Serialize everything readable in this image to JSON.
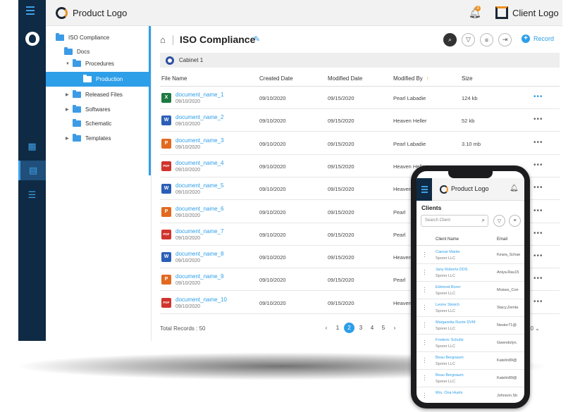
{
  "header": {
    "product_logo": "Product Logo",
    "client_logo": "Client Logo",
    "notification_count": "3"
  },
  "tree": {
    "items": [
      {
        "label": "ISO Compliance"
      },
      {
        "label": "Docs"
      },
      {
        "label": "Procedures"
      },
      {
        "label": "Production"
      },
      {
        "label": "Released Files"
      },
      {
        "label": "Softwares"
      },
      {
        "label": "Schematic"
      },
      {
        "label": "Templates"
      }
    ]
  },
  "main": {
    "title": "ISO Compliance",
    "record_label": "Record",
    "cabinet": "Cabinet 1",
    "columns": {
      "file_name": "File Name",
      "created": "Created Date",
      "modified": "Modified Date",
      "modified_by": "Modified By",
      "size": "Size"
    },
    "rows": [
      {
        "icon": "X",
        "icon_color": "#1e7a43",
        "name": "document_name_1",
        "sub": "09/10/2020",
        "created": "09/10/2020",
        "modified": "09/15/2020",
        "by": "Pearl Labadie",
        "size": "124 kb"
      },
      {
        "icon": "W",
        "icon_color": "#2b5fb7",
        "name": "document_name_2",
        "sub": "09/10/2020",
        "created": "09/10/2020",
        "modified": "09/15/2020",
        "by": "Heaven Heller",
        "size": "52 kb"
      },
      {
        "icon": "P",
        "icon_color": "#e2691f",
        "name": "document_name_3",
        "sub": "09/10/2020",
        "created": "09/10/2020",
        "modified": "09/15/2020",
        "by": "Pearl Labadie",
        "size": "3.10 mb"
      },
      {
        "icon": "PDF",
        "icon_color": "#d0342c",
        "name": "document_name_4",
        "sub": "09/10/2020",
        "created": "09/10/2020",
        "modified": "09/15/2020",
        "by": "Heaven Heller",
        "size": ""
      },
      {
        "icon": "W",
        "icon_color": "#2b5fb7",
        "name": "document_name_5",
        "sub": "09/10/2020",
        "created": "09/10/2020",
        "modified": "09/15/2020",
        "by": "Heaven",
        "size": ""
      },
      {
        "icon": "P",
        "icon_color": "#e2691f",
        "name": "document_name_6",
        "sub": "09/10/2020",
        "created": "09/10/2020",
        "modified": "09/15/2020",
        "by": "Pearl",
        "size": ""
      },
      {
        "icon": "PDF",
        "icon_color": "#d0342c",
        "name": "document_name_7",
        "sub": "09/10/2020",
        "created": "09/10/2020",
        "modified": "09/15/2020",
        "by": "Pearl",
        "size": ""
      },
      {
        "icon": "W",
        "icon_color": "#2b5fb7",
        "name": "document_name_8",
        "sub": "09/10/2020",
        "created": "09/10/2020",
        "modified": "09/15/2020",
        "by": "Heaven",
        "size": ""
      },
      {
        "icon": "P",
        "icon_color": "#e2691f",
        "name": "document_name_9",
        "sub": "09/10/2020",
        "created": "09/10/2020",
        "modified": "09/15/2020",
        "by": "Pearl",
        "size": ""
      },
      {
        "icon": "PDF",
        "icon_color": "#d0342c",
        "name": "document_name_10",
        "sub": "09/10/2020",
        "created": "09/10/2020",
        "modified": "09/15/2020",
        "by": "Heaven",
        "size": ""
      }
    ],
    "total_records": "Total Records : 50",
    "pages": [
      "1",
      "2",
      "3",
      "4",
      "5"
    ],
    "current_page": "2",
    "per_page": "10"
  },
  "phone": {
    "product_logo": "Product Logo",
    "notification_count": "3",
    "title": "Clients",
    "search_placeholder": "Search Client",
    "columns": {
      "client_name": "Client Name",
      "email": "Email"
    },
    "rows": [
      {
        "name": "Caesar Mante",
        "company": "Sporer LLC",
        "email": "Keara_Schae"
      },
      {
        "name": "Jany Roberts DDS",
        "company": "Sporer LLC",
        "email": "Aniya.Rau15"
      },
      {
        "name": "Edmond Borer",
        "company": "Sporer LLC",
        "email": "Moises_Con"
      },
      {
        "name": "Leone Streich",
        "company": "Sporer LLC",
        "email": "Stacy.Zemla"
      },
      {
        "name": "Margaretta Runte DVM",
        "company": "Sporer LLC",
        "email": "Nestor71@"
      },
      {
        "name": "Frederic Schultz",
        "company": "Sporer LLC",
        "email": "Gwendolyn."
      },
      {
        "name": "Beau Bergnaum",
        "company": "Sporer LLC",
        "email": "Katelin89@"
      },
      {
        "name": "Beau Bergnaum",
        "company": "Sporer LLC",
        "email": "Katelin89@"
      },
      {
        "name": "Mrs. Ona Huels",
        "company": "",
        "email": "Johnson.Str"
      }
    ]
  }
}
